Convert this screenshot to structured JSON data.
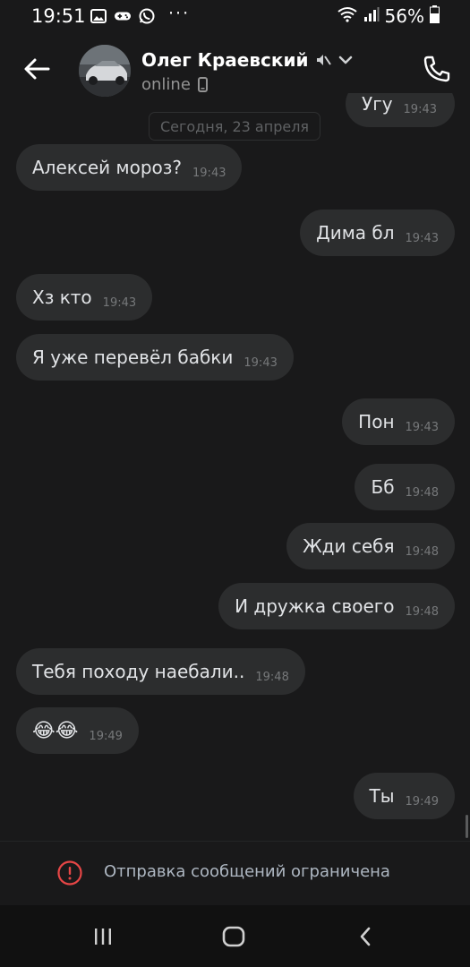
{
  "status_bar": {
    "time": "19:51",
    "battery_percent": "56%",
    "icons": [
      "gallery-icon",
      "game-icon",
      "whatsapp-icon",
      "more-dots-icon",
      "wifi-icon",
      "signal-icon",
      "battery-icon"
    ],
    "dots": "···"
  },
  "header": {
    "contact_name": "Олег Краевский",
    "status": "online",
    "icons": [
      "back-arrow-icon",
      "muted-icon",
      "chevron-down-icon",
      "mobile-device-icon",
      "phone-call-icon"
    ]
  },
  "chat": {
    "partial_top_message": {
      "text": "Угу",
      "time": "19:43",
      "outgoing": true
    },
    "date_separator": "Сегодня, 23 апреля",
    "messages": [
      {
        "text": "Алексей мороз?",
        "time": "19:43",
        "outgoing": false
      },
      {
        "text": "Дима бл",
        "time": "19:43",
        "outgoing": true
      },
      {
        "text": "Хз кто",
        "time": "19:43",
        "outgoing": false
      },
      {
        "text": "Я уже перевёл бабки",
        "time": "19:43",
        "outgoing": false
      },
      {
        "text": "Пон",
        "time": "19:43",
        "outgoing": true
      },
      {
        "text": "Бб",
        "time": "19:48",
        "outgoing": true
      },
      {
        "text": "Жди себя",
        "time": "19:48",
        "outgoing": true
      },
      {
        "text": "И дружка своего",
        "time": "19:48",
        "outgoing": true
      },
      {
        "text": "Тебя походу наебали..",
        "time": "19:48",
        "outgoing": false
      },
      {
        "text": "😂😂",
        "time": "19:49",
        "outgoing": false
      },
      {
        "text": "Ты",
        "time": "19:49",
        "outgoing": true
      }
    ]
  },
  "footer": {
    "restriction_text": "Отправка сообщений ограничена",
    "icon": "error-circle-icon"
  },
  "nav_bar": {
    "icons": [
      "recent-apps-icon",
      "home-icon",
      "back-icon"
    ]
  },
  "colors": {
    "background": "#19191a",
    "bubble": "#2c2d2e",
    "text": "#e1e3e6",
    "time": "#76787a",
    "error": "#e64646"
  }
}
